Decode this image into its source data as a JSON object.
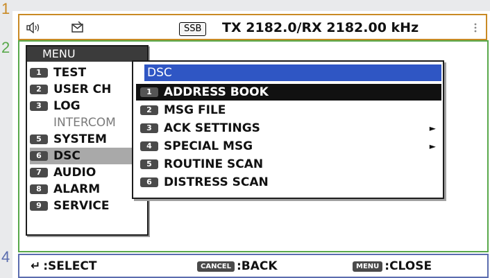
{
  "callouts": [
    "1",
    "2",
    "4"
  ],
  "status": {
    "mode_badge": "SSB",
    "frequency": "TX 2182.0/RX 2182.00 kHz"
  },
  "menu": {
    "title": "MENU",
    "items": [
      {
        "key": "1",
        "label": "TEST",
        "enabled": true
      },
      {
        "key": "2",
        "label": "USER CH",
        "enabled": true
      },
      {
        "key": "3",
        "label": "LOG",
        "enabled": true
      },
      {
        "key": "4",
        "label": "INTERCOM",
        "enabled": false
      },
      {
        "key": "5",
        "label": "SYSTEM",
        "enabled": true
      },
      {
        "key": "6",
        "label": "DSC",
        "enabled": true,
        "selected": true
      },
      {
        "key": "7",
        "label": "AUDIO",
        "enabled": true
      },
      {
        "key": "8",
        "label": "ALARM",
        "enabled": true
      },
      {
        "key": "9",
        "label": "SERVICE",
        "enabled": true
      }
    ]
  },
  "submenu": {
    "title": "DSC",
    "items": [
      {
        "key": "1",
        "label": "ADDRESS BOOK",
        "selected": true,
        "has_submenu": false
      },
      {
        "key": "2",
        "label": "MSG FILE",
        "has_submenu": false
      },
      {
        "key": "3",
        "label": "ACK SETTINGS",
        "has_submenu": true
      },
      {
        "key": "4",
        "label": "SPECIAL MSG",
        "has_submenu": true
      },
      {
        "key": "5",
        "label": "ROUTINE SCAN",
        "has_submenu": false
      },
      {
        "key": "6",
        "label": "DISTRESS SCAN",
        "has_submenu": false
      }
    ],
    "arrow_glyph": "►"
  },
  "bottom": {
    "select_glyph": "↵",
    "select_label": ":SELECT",
    "cancel_key": "CANCEL",
    "cancel_label": ":BACK",
    "menu_key": "MENU",
    "menu_label": ":CLOSE"
  }
}
